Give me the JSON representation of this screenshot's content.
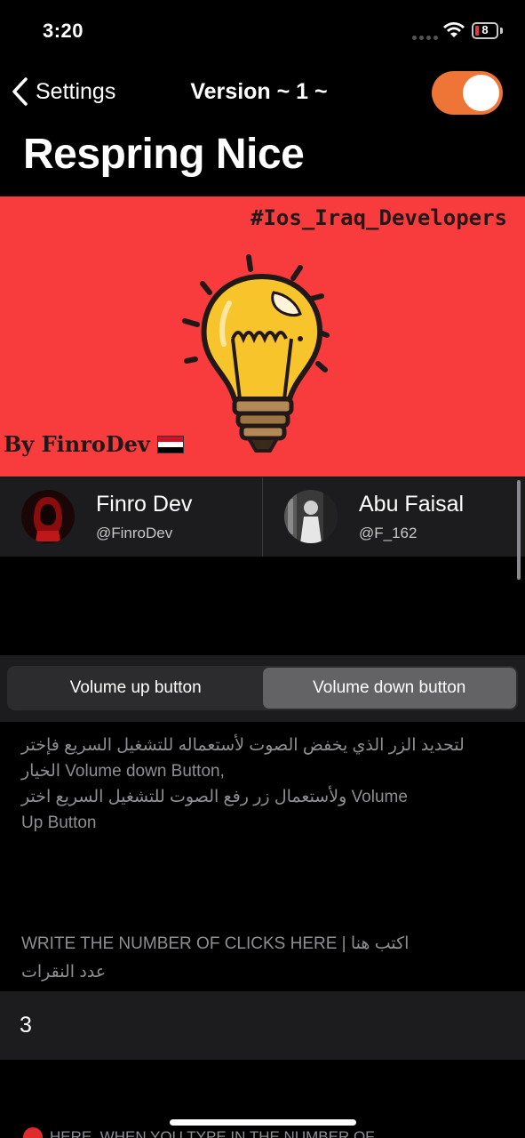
{
  "status_bar": {
    "time": "3:20",
    "battery_level": "8"
  },
  "nav": {
    "back_label": "Settings",
    "title": "Version ~ 1 ~",
    "toggle_on": true,
    "accent_color": "#ee7535"
  },
  "page_title": "Respring Nice",
  "banner": {
    "tag": "#Ios_Iraq_Developers",
    "by": "By FinroDev",
    "background_color": "#f83c3e"
  },
  "developers": [
    {
      "name": "Finro Dev",
      "handle": "@FinroDev"
    },
    {
      "name": "Abu Faisal",
      "handle": "@F_162"
    }
  ],
  "segmented": {
    "options": [
      "Volume up button",
      "Volume down button"
    ],
    "selected": "Volume down button"
  },
  "description_lines": [
    "لتحديد الزر الذي يخفض الصوت لأستعماله للتشغيل السريع فإختر",
    "الخيار Volume down Button,",
    "ولأستعمال زر رفع الصوت للتشغيل السريع اختر Volume",
    "Up Button"
  ],
  "clicks": {
    "header_line1": "WRITE THE NUMBER OF CLICKS HERE | اكتب هنا",
    "header_line2": "عدد النقرات",
    "value": "3"
  },
  "footer_note": "HERE, WHEN YOU TYPE IN THE NUMBER OF"
}
